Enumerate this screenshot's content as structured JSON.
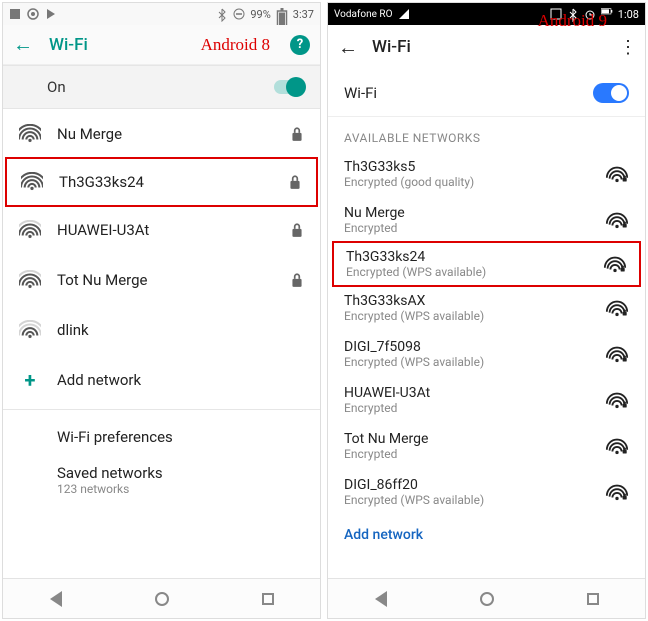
{
  "left": {
    "version_label": "Android 8",
    "statusbar": {
      "battery": "99%",
      "time": "3:37"
    },
    "appbar": {
      "title": "Wi-Fi"
    },
    "on_label": "On",
    "networks": [
      {
        "name": "Nu Merge",
        "signal": 4,
        "locked": true,
        "highlight": false
      },
      {
        "name": "Th3G33ks24",
        "signal": 4,
        "locked": true,
        "highlight": true
      },
      {
        "name": "HUAWEI-U3At",
        "signal": 3,
        "locked": true,
        "highlight": false
      },
      {
        "name": "Tot Nu Merge",
        "signal": 3,
        "locked": true,
        "highlight": false
      },
      {
        "name": "dlink",
        "signal": 2,
        "locked": false,
        "highlight": false
      }
    ],
    "add_network": "Add network",
    "prefs": "Wi-Fi preferences",
    "saved_title": "Saved networks",
    "saved_sub": "123 networks"
  },
  "right": {
    "version_label": "Android 9",
    "statusbar": {
      "carrier": "Vodafone RO",
      "time": "1:08"
    },
    "appbar": {
      "title": "Wi-Fi"
    },
    "on_label": "Wi-Fi",
    "section": "AVAILABLE NETWORKS",
    "networks": [
      {
        "name": "Th3G33ks5",
        "sub": "Encrypted (good quality)",
        "locked": true,
        "highlight": false
      },
      {
        "name": "Nu Merge",
        "sub": "Encrypted",
        "locked": true,
        "highlight": false
      },
      {
        "name": "Th3G33ks24",
        "sub": "Encrypted (WPS available)",
        "locked": true,
        "highlight": true
      },
      {
        "name": "Th3G33ksAX",
        "sub": "Encrypted (WPS available)",
        "locked": true,
        "highlight": false
      },
      {
        "name": "DIGI_7f5098",
        "sub": "Encrypted (WPS available)",
        "locked": true,
        "highlight": false
      },
      {
        "name": "HUAWEI-U3At",
        "sub": "Encrypted",
        "locked": true,
        "highlight": false
      },
      {
        "name": "Tot Nu Merge",
        "sub": "Encrypted",
        "locked": true,
        "highlight": false
      },
      {
        "name": "DIGI_86ff20",
        "sub": "Encrypted (WPS available)",
        "locked": true,
        "highlight": false
      }
    ],
    "add_network": "Add network"
  }
}
